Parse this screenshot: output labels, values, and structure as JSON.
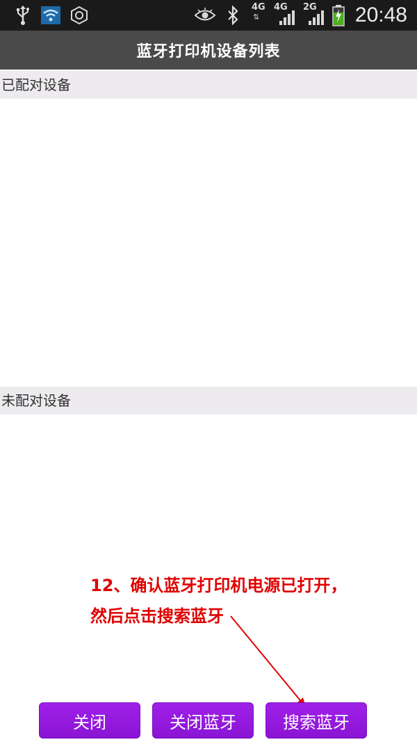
{
  "status_bar": {
    "time": "20:48",
    "icons": [
      "usb-icon",
      "wifi-icon",
      "settings-hex-icon",
      "eye-icon",
      "bluetooth-icon",
      "signal-4g-icon",
      "signal-4g-icon",
      "signal-2g-icon",
      "battery-charging-icon"
    ],
    "net1_tag": "4G",
    "net1_sub": "⇅",
    "net2_tag": "4G",
    "net3_tag": "2G"
  },
  "titlebar": {
    "title": "蓝牙打印机设备列表"
  },
  "paired": {
    "header": "已配对设备"
  },
  "unpaired": {
    "header": "未配对设备"
  },
  "annotation": {
    "line1": "12、确认蓝牙打印机电源已打开，",
    "line2": "然后点击搜索蓝牙"
  },
  "buttons": {
    "close": "关闭",
    "close_bt": "关闭蓝牙",
    "search_bt": "搜索蓝牙"
  },
  "colors": {
    "accent": "#9a1ee4",
    "annotation": "#e00000",
    "titlebar": "#4a4a4a",
    "section": "#eeebef"
  }
}
